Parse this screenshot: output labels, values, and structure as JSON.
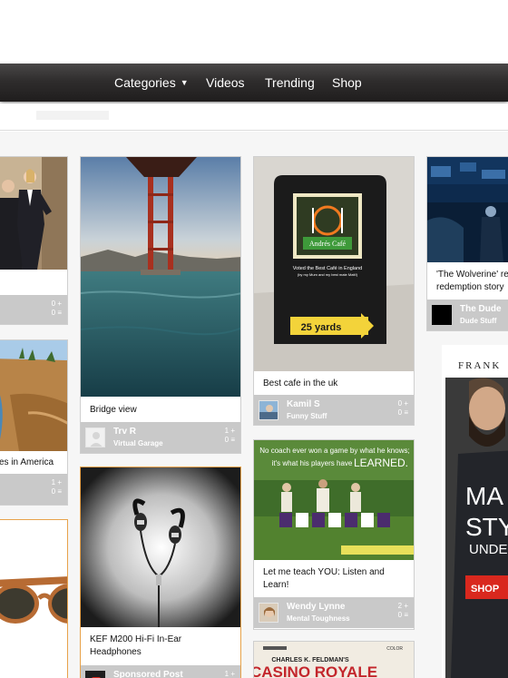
{
  "nav": {
    "categories": "Categories",
    "videos": "Videos",
    "trending": "Trending",
    "shop": "Shop"
  },
  "pins": [
    {
      "caption": "",
      "user": "",
      "board": "",
      "likes": "0",
      "comments": "0"
    },
    {
      "caption": "es in America",
      "user": "",
      "board": "",
      "likes": "1",
      "comments": "0"
    },
    {
      "caption": "",
      "user": "",
      "board": "",
      "likes": "",
      "comments": ""
    },
    {
      "caption": "Bridge view",
      "user": "Trv R",
      "board": "Virtual Garage",
      "likes": "1",
      "comments": "0"
    },
    {
      "caption": "KEF M200 Hi-Fi In-Ear Headphones",
      "user": "Sponsored Post",
      "board": "",
      "likes": "1",
      "comments": "0"
    },
    {
      "caption": "Best cafe in the uk",
      "user": "Kamil S",
      "board": "Funny Stuff",
      "likes": "0",
      "comments": "0"
    },
    {
      "caption": "Let me teach YOU: Listen and Learn!",
      "user": "Wendy Lynne",
      "board": "Mental Toughness",
      "likes": "2",
      "comments": "0"
    },
    {
      "caption": "'The Wolverine' re redemption story",
      "user": "The Dude",
      "board": "Dude Stuff",
      "likes": "",
      "comments": ""
    }
  ],
  "images": {
    "cafe_sign": {
      "name": "Andrés Café",
      "line1": "Voted the Best Café in England",
      "line2": "(by my Mum and my best mate Matt!)",
      "arrow": "25 yards"
    },
    "football": {
      "line1": "No coach ever won a game by what he knows;",
      "line2": "it's what his players have",
      "emph": "LEARNED."
    },
    "casino": {
      "top": "CHARLES K. FELDMAN'S",
      "title": "CASINO ROYALE",
      "corner": "COLOR"
    },
    "ad": {
      "brand": "FRANK",
      "w1": "MA",
      "w2": "STY",
      "w3": "UNDE",
      "cta": "SHOP"
    }
  },
  "colors": {
    "footer": "#c9c9c9",
    "navbar": "#2f2d2d",
    "sponsored_border": "#e8a24a",
    "ad_cta": "#d9281e"
  }
}
